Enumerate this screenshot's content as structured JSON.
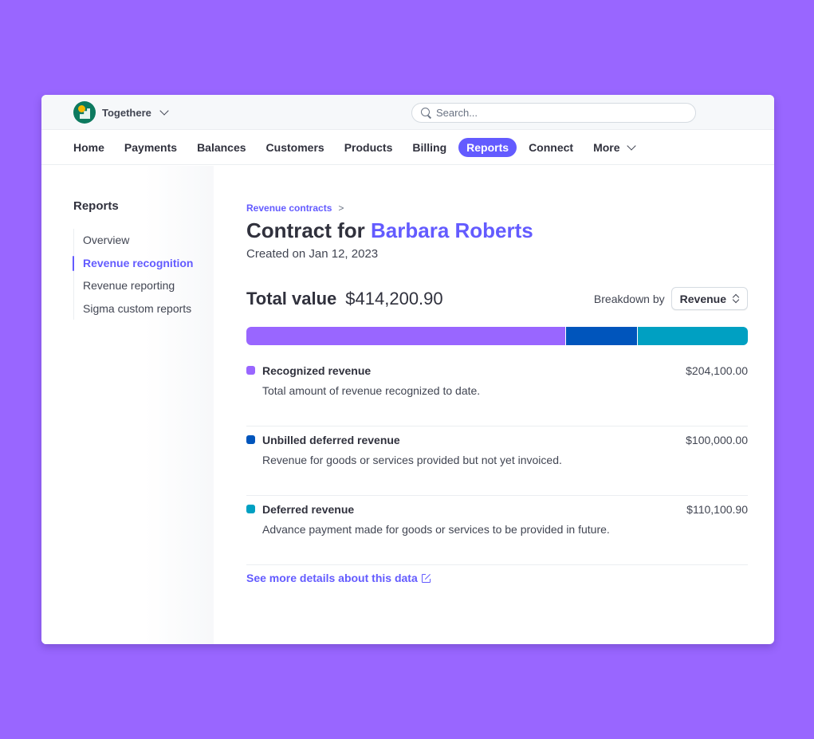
{
  "topbar": {
    "account_name": "Togethere",
    "search_placeholder": "Search..."
  },
  "nav": {
    "items": [
      {
        "label": "Home"
      },
      {
        "label": "Payments"
      },
      {
        "label": "Balances"
      },
      {
        "label": "Customers"
      },
      {
        "label": "Products"
      },
      {
        "label": "Billing"
      },
      {
        "label": "Reports",
        "active": true
      },
      {
        "label": "Connect"
      },
      {
        "label": "More",
        "icon": "chevron-down-icon"
      }
    ]
  },
  "sidebar": {
    "title": "Reports",
    "items": [
      {
        "label": "Overview"
      },
      {
        "label": "Revenue recognition",
        "active": true
      },
      {
        "label": "Revenue reporting"
      },
      {
        "label": "Sigma custom reports"
      }
    ]
  },
  "main": {
    "breadcrumb": "Revenue contracts",
    "breadcrumb_sep": ">",
    "title_prefix": "Contract for",
    "title_name": "Barbara Roberts",
    "created": "Created on Jan 12, 2023",
    "total_label": "Total value",
    "total_value": "$414,200.90",
    "breakdown_label": "Breakdown by",
    "breakdown_value": "Revenue",
    "bar": [
      {
        "key": "recognized",
        "share": 0.638,
        "color": "#9966ff"
      },
      {
        "key": "unbilled",
        "share": 0.142,
        "color": "#0055bc"
      },
      {
        "key": "deferred",
        "share": 0.22,
        "color": "#00a0c2"
      }
    ],
    "items": [
      {
        "name": "Recognized revenue",
        "description": "Total amount of revenue recognized to date.",
        "amount": "$204,100.00",
        "color": "#9966ff"
      },
      {
        "name": "Unbilled deferred revenue",
        "description": "Revenue for goods or services provided but not yet invoiced.",
        "amount": "$100,000.00",
        "color": "#0055bc"
      },
      {
        "name": "Deferred revenue",
        "description": "Advance payment made for goods or services to be provided in future.",
        "amount": "$110,100.90",
        "color": "#00a0c2"
      }
    ],
    "more_link": "See more details about this data"
  },
  "colors": {
    "accent": "#635bff",
    "background": "#9966ff"
  }
}
